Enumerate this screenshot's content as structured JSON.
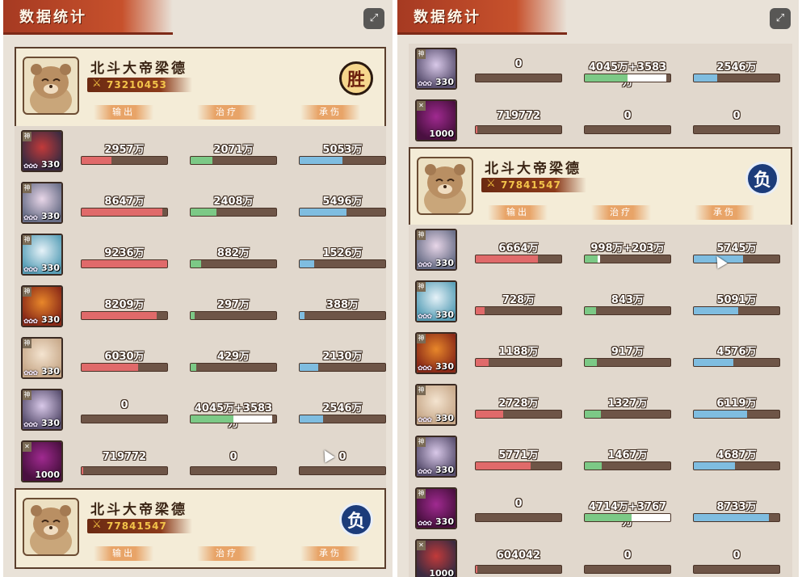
{
  "colors": {
    "damage": "#e06a6a",
    "heal": "#7cc986",
    "tank": "#7fbde0",
    "heal_secondary": "#ffffff"
  },
  "left_panel": {
    "title": "数据统计",
    "expand_icon": "expand-icon",
    "team_top": {
      "name": "北斗大帝梁德",
      "power": "73210453",
      "result": "胜",
      "result_type": "win",
      "labels": [
        "输出",
        "治疗",
        "承伤"
      ]
    },
    "rows": [
      {
        "level": "330",
        "stars": "✿✿✿",
        "damage": "2957万",
        "damage_ratio": 0.35,
        "heal": "2071万",
        "heal_ratio": 0.25,
        "tank": "5053万",
        "tank_ratio": 0.5
      },
      {
        "level": "330",
        "stars": "✿✿✿",
        "damage": "8647万",
        "damage_ratio": 0.94,
        "heal": "2408万",
        "heal_ratio": 0.3,
        "tank": "5496万",
        "tank_ratio": 0.55
      },
      {
        "level": "330",
        "stars": "✿✿✿",
        "damage": "9236万",
        "damage_ratio": 1.0,
        "heal": "882万",
        "heal_ratio": 0.12,
        "tank": "1526万",
        "tank_ratio": 0.17
      },
      {
        "level": "330",
        "stars": "✿✿✿",
        "damage": "8209万",
        "damage_ratio": 0.88,
        "heal": "297万",
        "heal_ratio": 0.05,
        "tank": "388万",
        "tank_ratio": 0.06
      },
      {
        "level": "330",
        "stars": "✿✿✿",
        "damage": "6030万",
        "damage_ratio": 0.66,
        "heal": "429万",
        "heal_ratio": 0.07,
        "tank": "2130万",
        "tank_ratio": 0.22
      },
      {
        "level": "330",
        "stars": "✿✿✿",
        "damage": "0",
        "damage_ratio": 0,
        "heal": "4045万+3583万",
        "heal_ratio": 0.5,
        "heal_ratio2": 0.45,
        "tank": "2546万",
        "tank_ratio": 0.27
      },
      {
        "level": "1000",
        "stars": "",
        "damage": "719772",
        "damage_ratio": 0.02,
        "heal": "0",
        "heal_ratio": 0,
        "tank": "0",
        "tank_ratio": 0
      }
    ],
    "team_bottom": {
      "name": "北斗大帝梁德",
      "power": "77841547",
      "result": "负",
      "result_type": "lose",
      "labels": [
        "输出",
        "治疗",
        "承伤"
      ]
    }
  },
  "right_panel": {
    "title": "数据统计",
    "expand_icon": "expand-icon",
    "rows_top": [
      {
        "level": "330",
        "stars": "✿✿✿",
        "damage": "0",
        "damage_ratio": 0,
        "heal": "4045万+3583万",
        "heal_ratio": 0.5,
        "heal_ratio2": 0.45,
        "tank": "2546万",
        "tank_ratio": 0.27
      },
      {
        "level": "1000",
        "stars": "",
        "damage": "719772",
        "damage_ratio": 0.02,
        "heal": "0",
        "heal_ratio": 0,
        "tank": "0",
        "tank_ratio": 0
      }
    ],
    "team": {
      "name": "北斗大帝梁德",
      "power": "77841547",
      "result": "负",
      "result_type": "lose",
      "labels": [
        "输出",
        "治疗",
        "承伤"
      ]
    },
    "rows_bottom": [
      {
        "level": "330",
        "stars": "✿✿✿",
        "damage": "6664万",
        "damage_ratio": 0.73,
        "heal": "998万+203万",
        "heal_ratio": 0.15,
        "heal_ratio2": 0.03,
        "tank": "5745万",
        "tank_ratio": 0.58
      },
      {
        "level": "330",
        "stars": "✿✿✿",
        "damage": "728万",
        "damage_ratio": 0.1,
        "heal": "843万",
        "heal_ratio": 0.13,
        "tank": "5091万",
        "tank_ratio": 0.52
      },
      {
        "level": "330",
        "stars": "✿✿✿",
        "damage": "1188万",
        "damage_ratio": 0.15,
        "heal": "917万",
        "heal_ratio": 0.14,
        "tank": "4576万",
        "tank_ratio": 0.46
      },
      {
        "level": "330",
        "stars": "✿✿✿",
        "damage": "2728万",
        "damage_ratio": 0.32,
        "heal": "1327万",
        "heal_ratio": 0.19,
        "tank": "6119万",
        "tank_ratio": 0.62
      },
      {
        "level": "330",
        "stars": "✿✿✿",
        "damage": "5771万",
        "damage_ratio": 0.64,
        "heal": "1467万",
        "heal_ratio": 0.2,
        "tank": "4687万",
        "tank_ratio": 0.48
      },
      {
        "level": "330",
        "stars": "✿✿✿",
        "damage": "0",
        "damage_ratio": 0,
        "heal": "4714万+3767万",
        "heal_ratio": 0.55,
        "heal_ratio2": 0.45,
        "tank": "8733万",
        "tank_ratio": 0.88
      },
      {
        "level": "1000",
        "stars": "",
        "damage": "604042",
        "damage_ratio": 0.02,
        "heal": "0",
        "heal_ratio": 0,
        "tank": "0",
        "tank_ratio": 0
      }
    ]
  }
}
